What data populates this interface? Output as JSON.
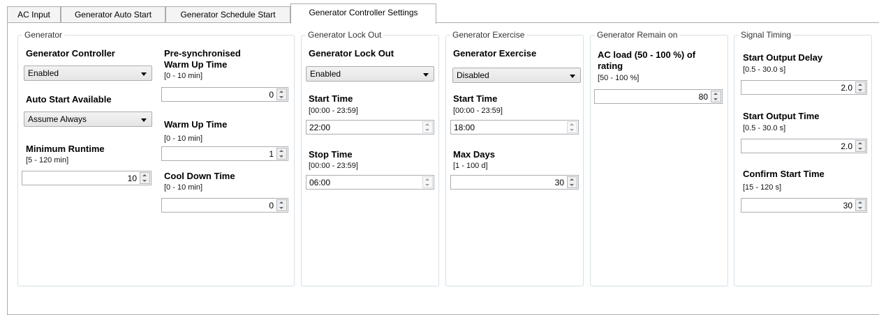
{
  "tabs": {
    "ac_input": "AC Input",
    "auto_start": "Generator Auto Start",
    "schedule_start": "Generator Schedule Start",
    "controller_settings": "Generator Controller Settings"
  },
  "generator": {
    "title": "Generator",
    "controller_label": "Generator Controller",
    "controller_value": "Enabled",
    "auto_start_label": "Auto Start Available",
    "auto_start_value": "Assume Always",
    "min_runtime_label": "Minimum Runtime",
    "min_runtime_range": "[5 - 120 min]",
    "min_runtime_value": "10",
    "presync_label_1": "Pre-synchronised",
    "presync_label_2": "Warm Up Time",
    "presync_range": "[0 - 10 min]",
    "presync_value": "0",
    "warmup_label": "Warm Up Time",
    "warmup_range": "[0 - 10 min]",
    "warmup_value": "1",
    "cooldown_label": "Cool Down Time",
    "cooldown_range": "[0 - 10 min]",
    "cooldown_value": "0"
  },
  "lockout": {
    "title": "Generator Lock Out",
    "label": "Generator Lock Out",
    "value": "Enabled",
    "start_label": "Start Time",
    "start_range": "[00:00 - 23:59]",
    "start_value": "22:00",
    "stop_label": "Stop Time",
    "stop_range": "[00:00 - 23:59]",
    "stop_value": "06:00"
  },
  "exercise": {
    "title": "Generator Exercise",
    "label": "Generator Exercise",
    "value": "Disabled",
    "start_label": "Start Time",
    "start_range": "[00:00 - 23:59]",
    "start_value": "18:00",
    "max_days_label": "Max Days",
    "max_days_range": "[1 - 100 d]",
    "max_days_value": "30"
  },
  "remain_on": {
    "title": "Generator Remain on",
    "label_1": "AC load (50 - 100 %) of",
    "label_2": "rating",
    "range": "[50 - 100 %]",
    "value": "80"
  },
  "signal_timing": {
    "title": "Signal Timing",
    "delay_label": "Start Output Delay",
    "delay_range": "[0.5 - 30.0 s]",
    "delay_value": "2.0",
    "output_time_label": "Start Output Time",
    "output_time_range": "[0.5 - 30.0 s]",
    "output_time_value": "2.0",
    "confirm_label": "Confirm Start Time",
    "confirm_range": "[15 - 120 s]",
    "confirm_value": "30"
  }
}
